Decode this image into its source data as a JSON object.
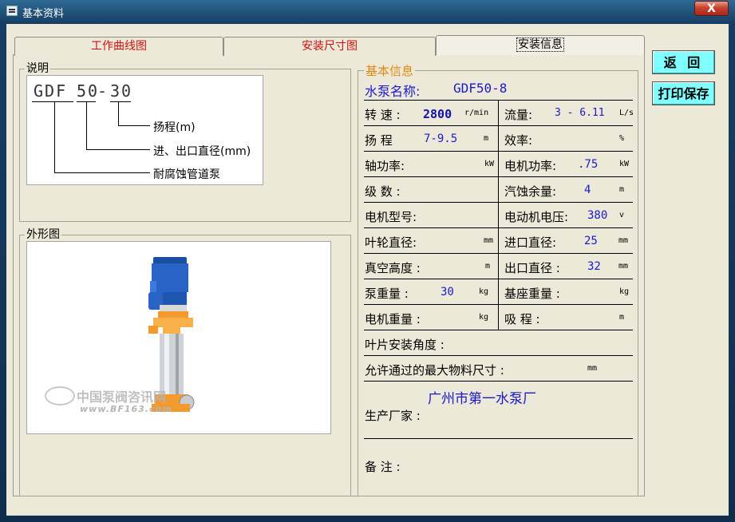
{
  "window": {
    "title": "基本资料",
    "close_label": "X"
  },
  "tabs": [
    "工作曲线图",
    "安装尺寸图",
    "安装信息"
  ],
  "description": {
    "label": "说明",
    "model_prefix": "GDF",
    "model_diameter": "50",
    "model_head": "30",
    "dash": "-",
    "legend_head": "扬程(m)",
    "legend_diameter": "进、出口直径(mm)",
    "legend_prefix": "耐腐蚀管道泵"
  },
  "appearance": {
    "label": "外形图",
    "watermark_cn": "中国泵阀咨讯网",
    "watermark_url": "www.BF163.com"
  },
  "info": {
    "label": "基本信息",
    "pump_name_label": "水泵名称:",
    "pump_name": "GDF50-8",
    "speed_label": "转 速 :",
    "speed": "2800",
    "speed_unit": "r/min",
    "flow_label": "流量:",
    "flow": "3 - 6.11",
    "flow_unit": "L/s",
    "head_label": "扬 程",
    "head": "7-9.5",
    "head_unit": "m",
    "eff_label": "效率:",
    "eff_unit": "%",
    "shaft_power_label": "轴功率:",
    "shaft_power_unit": "kW",
    "motor_power_label": "电机功率:",
    "motor_power": ".75",
    "motor_power_unit": "kW",
    "stages_label": "级 数 :",
    "npsh_label": "汽蚀余量:",
    "npsh": "4",
    "npsh_unit": "m",
    "motor_model_label": "电机型号:",
    "motor_voltage_label": "电动机电压:",
    "motor_voltage": "380",
    "motor_voltage_unit": "v",
    "impeller_label": "叶轮直径:",
    "impeller_unit": "mm",
    "inlet_label": "进口直径:",
    "inlet": "25",
    "inlet_unit": "mm",
    "vacuum_label": "真空高度 :",
    "vacuum_unit": "m",
    "outlet_label": "出口直径 :",
    "outlet": "32",
    "outlet_unit": "mm",
    "pump_weight_label": "泵重量 :",
    "pump_weight": "30",
    "pump_weight_unit": "kg",
    "base_weight_label": "基座重量 :",
    "base_weight_unit": "kg",
    "motor_weight_label": "电机重量 :",
    "motor_weight_unit": "kg",
    "suction_label": "吸 程 :",
    "suction_unit": "m",
    "blade_angle_label": "叶片安装角度 :",
    "max_particle_label": "允许通过的最大物料尺寸 :",
    "max_particle_unit": "mm",
    "manufacturer": "广州市第一水泵厂",
    "manufacturer_label": "生产厂家 :",
    "remark_label": "备 注 :"
  },
  "buttons": {
    "back": "返 回",
    "print_save": "打印保存"
  }
}
